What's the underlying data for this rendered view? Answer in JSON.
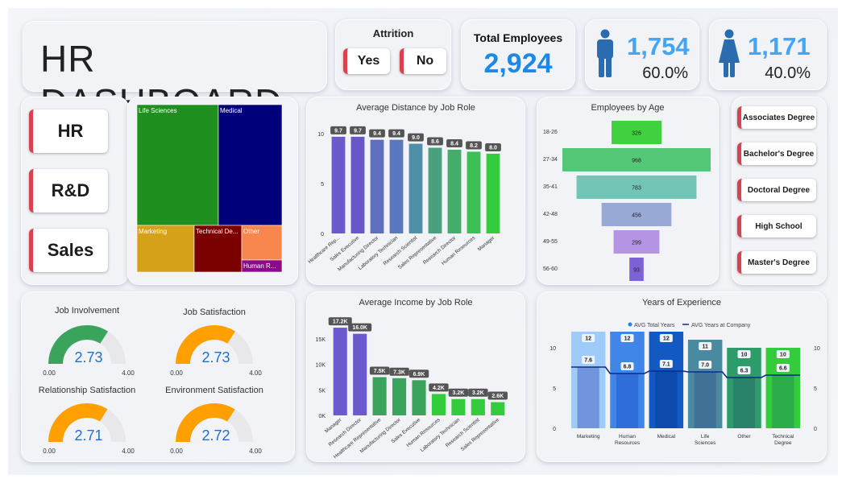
{
  "header": {
    "title": "HR DASHBOARD"
  },
  "attrition": {
    "title": "Attrition",
    "yes_label": "Yes",
    "no_label": "No"
  },
  "total": {
    "label": "Total Employees",
    "value": "2,924"
  },
  "male": {
    "count": "1,754",
    "pct": "60.0%",
    "icon": "male-person-icon"
  },
  "female": {
    "count": "1,171",
    "pct": "40.0%",
    "icon": "female-person-icon"
  },
  "departments": {
    "items": [
      "HR",
      "R&D",
      "Sales"
    ]
  },
  "education": {
    "items": [
      "Associates Degree",
      "Bachelor's Degree",
      "Doctoral Degree",
      "High School",
      "Master's Degree"
    ]
  },
  "colors": {
    "accent": "#d9414f",
    "blue": "#1e88e5",
    "gauge_green": "#3aa35c",
    "gauge_orange": "#ffa000"
  },
  "chart_data": [
    {
      "type": "treemap",
      "title": "",
      "labels": [
        "Life Sciences",
        "Medical",
        "Marketing",
        "Technical De...",
        "Other",
        "Human R..."
      ],
      "colors": [
        "#1f8f1f",
        "#00007a",
        "#d4a118",
        "#7b0000",
        "#f7864f",
        "#8a0a8a"
      ]
    },
    {
      "type": "bar",
      "title": "Average Distance by Job Role",
      "categories": [
        "Healthcare Rep...",
        "Sales Executive",
        "Manufacturing Director",
        "Laboratory Technician",
        "Research Scientist",
        "Sales Representative",
        "Research Director",
        "Human Resources",
        "Manager"
      ],
      "values": [
        9.7,
        9.7,
        9.4,
        9.4,
        9.0,
        8.6,
        8.4,
        8.2,
        8.0
      ],
      "value_labels": [
        "9.7",
        "9.7",
        "9.4",
        "9.4",
        "9.0",
        "8.6",
        "8.4",
        "8.2",
        "8.0"
      ],
      "colors": [
        "#6a5acd",
        "#6757c9",
        "#5f6fc0",
        "#5a78bd",
        "#4f8fa8",
        "#48a07f",
        "#44ad6b",
        "#3cbf55",
        "#33cc3d"
      ],
      "yticks": [
        "0",
        "5",
        "10"
      ],
      "ylim": [
        0,
        10.5
      ]
    },
    {
      "type": "bar",
      "title": "Employees by Age",
      "categories": [
        "18-26",
        "27-34",
        "35-41",
        "42-48",
        "49-55",
        "56-60"
      ],
      "values": [
        326,
        968,
        783,
        456,
        299,
        93
      ],
      "value_labels": [
        "326",
        "968",
        "783",
        "456",
        "299",
        "93"
      ],
      "colors": [
        "#3fd13f",
        "#55c878",
        "#72c4b4",
        "#98a9d6",
        "#b594e6",
        "#7d62d6"
      ]
    },
    {
      "type": "bar",
      "title": "Average Income by Job Role",
      "categories": [
        "Manager",
        "Research Director",
        "Healthcare Representative",
        "Manufacturing Director",
        "Sales Executive",
        "Human Resources",
        "Laboratory Technician",
        "Research Scientist",
        "Sales Representative"
      ],
      "values": [
        17.2,
        16.0,
        7.5,
        7.3,
        6.9,
        4.2,
        3.2,
        3.2,
        2.6
      ],
      "value_labels": [
        "17.2K",
        "16.0K",
        "7.5K",
        "7.3K",
        "6.9K",
        "4.2K",
        "3.2K",
        "3.2K",
        "2.6K"
      ],
      "colors": [
        "#6a5acd",
        "#6a5acd",
        "#3aa35c",
        "#3aa35c",
        "#3aa35c",
        "#33cc3d",
        "#33cc3d",
        "#33cc3d",
        "#33cc3d"
      ],
      "yticks": [
        "0K",
        "5K",
        "10K",
        "15K"
      ],
      "ylim": [
        0,
        18
      ]
    },
    {
      "type": "bar",
      "title": "Years of Experience",
      "categories": [
        "Marketing",
        "Human Resources",
        "Medical",
        "Life Sciences",
        "Other",
        "Technical Degree"
      ],
      "series": [
        {
          "name": "AVG Total Years",
          "values": [
            12,
            12,
            12,
            11,
            10,
            10
          ],
          "labels": [
            "12",
            "12",
            "12",
            "11",
            "10",
            "10"
          ]
        },
        {
          "name": "AVG Years at Company",
          "values": [
            7.6,
            6.8,
            7.1,
            7.0,
            6.3,
            6.6
          ],
          "labels": [
            "7.6",
            "6.8",
            "7.1",
            "7.0",
            "6.3",
            "6.6"
          ]
        }
      ],
      "bar_colors": [
        "#9ecbfa",
        "#3f86e8",
        "#1259c4",
        "#4a8aa0",
        "#2e9c6a",
        "#33cc3d"
      ],
      "inner_colors": [
        "#6d8ed8",
        "#2d6bd6",
        "#0c49a8",
        "#3f6f95",
        "#2a7f6b",
        "#2aa84a"
      ],
      "yticks": [
        "0",
        "5",
        "10"
      ],
      "ylim": [
        0,
        13
      ]
    },
    {
      "type": "gauge",
      "gauges": [
        {
          "title": "Job Involvement",
          "value": 2.73,
          "label": "2.73",
          "min": "0.00",
          "max": "4.00",
          "color": "#3aa35c"
        },
        {
          "title": "Job Satisfaction",
          "value": 2.73,
          "label": "2.73",
          "min": "0.00",
          "max": "4.00",
          "color": "#ffa000"
        },
        {
          "title": "Relationship Satisfaction",
          "value": 2.71,
          "label": "2.71",
          "min": "0.00",
          "max": "4.00",
          "color": "#ffa000"
        },
        {
          "title": "Environment Satisfaction",
          "value": 2.72,
          "label": "2.72",
          "min": "0.00",
          "max": "4.00",
          "color": "#ffa000"
        }
      ]
    }
  ]
}
